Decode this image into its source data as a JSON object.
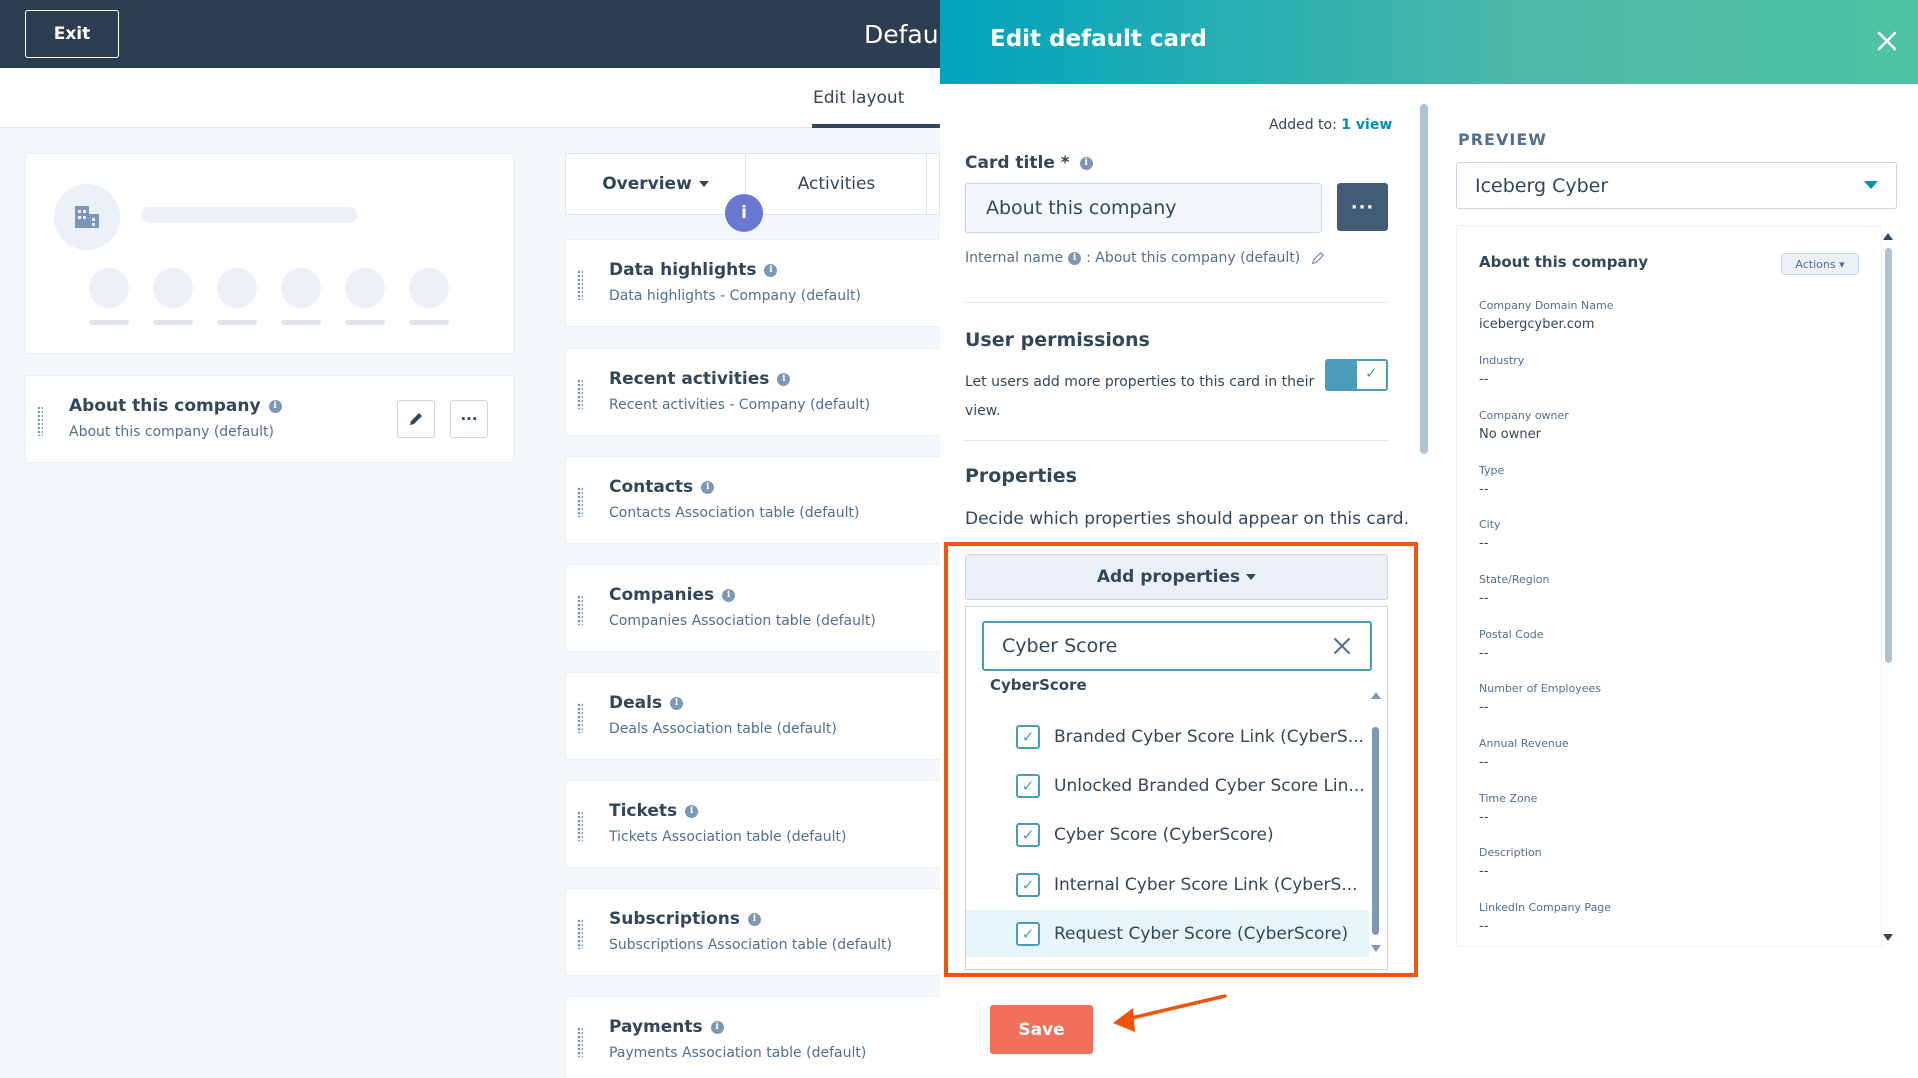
{
  "header": {
    "exit_label": "Exit",
    "title": "Defaul",
    "sub_tab": "Edit layout"
  },
  "left": {
    "about_card": {
      "title": "About this company",
      "subtitle": "About this company (default)",
      "more_glyph": "···"
    }
  },
  "middle": {
    "tabs": [
      {
        "label": "Overview"
      },
      {
        "label": "Activities"
      }
    ],
    "info_badge": "i",
    "cards": [
      {
        "title": "Data highlights",
        "subtitle": "Data highlights - Company (default)"
      },
      {
        "title": "Recent activities",
        "subtitle": "Recent activities - Company (default)"
      },
      {
        "title": "Contacts",
        "subtitle": "Contacts Association table (default)"
      },
      {
        "title": "Companies",
        "subtitle": "Companies Association table (default)"
      },
      {
        "title": "Deals",
        "subtitle": "Deals Association table (default)"
      },
      {
        "title": "Tickets",
        "subtitle": "Tickets Association table (default)"
      },
      {
        "title": "Subscriptions",
        "subtitle": "Subscriptions Association table (default)"
      },
      {
        "title": "Payments",
        "subtitle": "Payments Association table (default)"
      }
    ]
  },
  "panel": {
    "title": "Edit default card",
    "added_to_label": "Added to:",
    "added_to_link": "1 view",
    "card_title_label": "Card title *",
    "card_title_value": "About this company",
    "more_glyph": "···",
    "internal_name_label": "Internal name",
    "internal_name_value": ": About this company (default)",
    "user_permissions_heading": "User permissions",
    "user_permissions_text": "Let users add more properties to this card in their view.",
    "toggle_on": true,
    "properties_heading": "Properties",
    "properties_desc": "Decide which properties should appear on this card.",
    "add_properties_label": "Add properties",
    "search_value": "Cyber Score",
    "group_header": "CyberScore",
    "options": [
      {
        "label": "Branded Cyber Score Link (CyberS...",
        "checked": true
      },
      {
        "label": "Unlocked Branded Cyber Score Lin...",
        "checked": true
      },
      {
        "label": "Cyber Score (CyberScore)",
        "checked": true
      },
      {
        "label": "Internal Cyber Score Link (CyberS...",
        "checked": true
      },
      {
        "label": "Request Cyber Score (CyberScore)",
        "checked": true
      }
    ],
    "save_label": "Save"
  },
  "preview": {
    "label": "PREVIEW",
    "selected_record": "Iceberg Cyber",
    "card_title": "About this company",
    "actions_label": "Actions",
    "properties": [
      {
        "label": "Company Domain Name",
        "value": "icebergcyber.com"
      },
      {
        "label": "Industry",
        "value": "--"
      },
      {
        "label": "Company owner",
        "value": "No owner"
      },
      {
        "label": "Type",
        "value": "--"
      },
      {
        "label": "City",
        "value": "--"
      },
      {
        "label": "State/Region",
        "value": "--"
      },
      {
        "label": "Postal Code",
        "value": "--"
      },
      {
        "label": "Number of Employees",
        "value": "--"
      },
      {
        "label": "Annual Revenue",
        "value": "--"
      },
      {
        "label": "Time Zone",
        "value": "--"
      },
      {
        "label": "Description",
        "value": "--"
      },
      {
        "label": "LinkedIn Company Page",
        "value": "--"
      }
    ]
  },
  "colors": {
    "header_bg": "#2d3e50",
    "panel_gradient_start": "#00a4bd",
    "panel_gradient_end": "#4fc3a1",
    "accent": "#0091ae",
    "save_button": "#f2705a",
    "highlight_border": "#f0540a"
  },
  "icons": [
    "building-icon",
    "info-icon",
    "edit-pencil-icon",
    "close-icon",
    "caret-down-icon",
    "checkmark-icon",
    "drag-handle-icon",
    "arrow-annotation-icon"
  ]
}
